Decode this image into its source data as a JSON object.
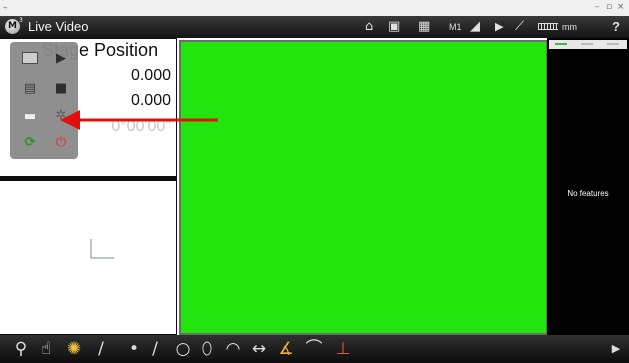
{
  "app": {
    "title": "Live Video",
    "logo_letter": "M",
    "logo_superscript": "3"
  },
  "window_controls": {
    "minimize": "–",
    "maximize": "▫",
    "close": "×"
  },
  "toolbar": {
    "home_icon": "⌂",
    "video_icon": "▣",
    "grid_icon": "▦",
    "mode_label": "M1",
    "angle_icon": "◢",
    "play_icon": "▶",
    "probe_icon": "⟋",
    "unit_label": "mm",
    "help_label": "?"
  },
  "dro": {
    "title": "Stage Position",
    "x_value": "0.000",
    "y_value": "0.000",
    "q_value": "0°00'00\""
  },
  "popup": {
    "items": [
      {
        "icon": "camera-icon",
        "glyph": "▭"
      },
      {
        "icon": "play-icon",
        "glyph": "▶"
      },
      {
        "icon": "document-icon",
        "glyph": "▤"
      },
      {
        "icon": "save-icon",
        "glyph": "■"
      },
      {
        "icon": "print-icon",
        "glyph": "▬"
      },
      {
        "icon": "gear-icon",
        "glyph": "✲"
      },
      {
        "icon": "refresh-icon",
        "glyph": "⟳"
      },
      {
        "icon": "power-icon",
        "glyph": "⏻"
      }
    ]
  },
  "features": {
    "empty_text": "No features"
  },
  "bottom_tools": {
    "zoom": "⚲",
    "hand": "☝",
    "light": "✺",
    "probe": "/",
    "point": "•",
    "line": "∕",
    "circle": "○",
    "slot": "⬯",
    "arc": "◠",
    "distance": "↔",
    "angle": "∡",
    "curve": "⌒",
    "perpendicular": "⊥",
    "expand": "▶"
  },
  "colors": {
    "video_background": "#22e50d",
    "annotation_arrow": "#e01010",
    "titlebar": "#1f1f1f"
  }
}
